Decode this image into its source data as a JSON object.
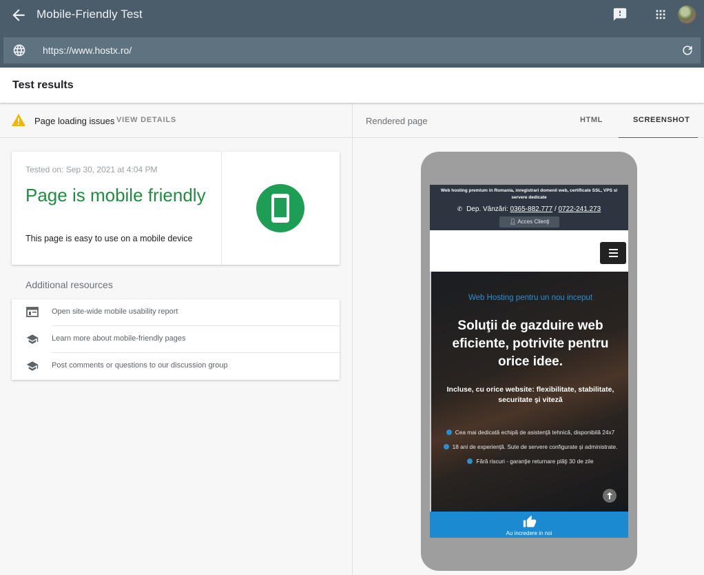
{
  "appbar": {
    "title": "Mobile-Friendly Test",
    "url": "https://www.hostx.ro/"
  },
  "results": {
    "title": "Test results"
  },
  "issues": {
    "text": "Page loading issues",
    "link": "VIEW DETAILS"
  },
  "card": {
    "tested_on": "Tested on: Sep 30, 2021 at 4:04 PM",
    "verdict": "Page is mobile friendly",
    "subtitle": "This page is easy to use on a mobile device",
    "accent": "#1e8e3e"
  },
  "resources": {
    "title": "Additional resources",
    "items": [
      {
        "label": "Open site-wide mobile usability report",
        "icon": "report-icon"
      },
      {
        "label": "Learn more about mobile-friendly pages",
        "icon": "school-icon"
      },
      {
        "label": "Post comments or questions to our discussion group",
        "icon": "school-icon"
      }
    ]
  },
  "right": {
    "label": "Rendered page",
    "tabs": [
      "HTML",
      "SCREENSHOT"
    ],
    "active_tab": "SCREENSHOT"
  },
  "site": {
    "tagline": "Web hosting premium in Romania, inregistrari domenii web, certificate SSL, VPS si servere dedicate",
    "dep_label": "Dep. Vânzări:",
    "phone1": "0365-882.777",
    "slash": "/",
    "phone2": "0722-241.273",
    "acces": "Acces Clienţi",
    "kicker": "Web Hosting pentru un nou inceput",
    "headline": "Soluţii de gazduire web eficiente, potrivite pentru orice idee.",
    "sub": "Incluse, cu orice website: flexibilitate, stabilitate, securitate şi viteză",
    "features": [
      "Cea mai dedicată echipă de asistenţă tehnică, disponibilă 24x7",
      "18 ani de experienţă. Sute de servere configurate şi administrate.",
      "Fără riscuri - garanţie returnare plăţi 30 de zile"
    ],
    "trust": "Au incredere in noi",
    "brand_blue": "#2a8fd0"
  }
}
